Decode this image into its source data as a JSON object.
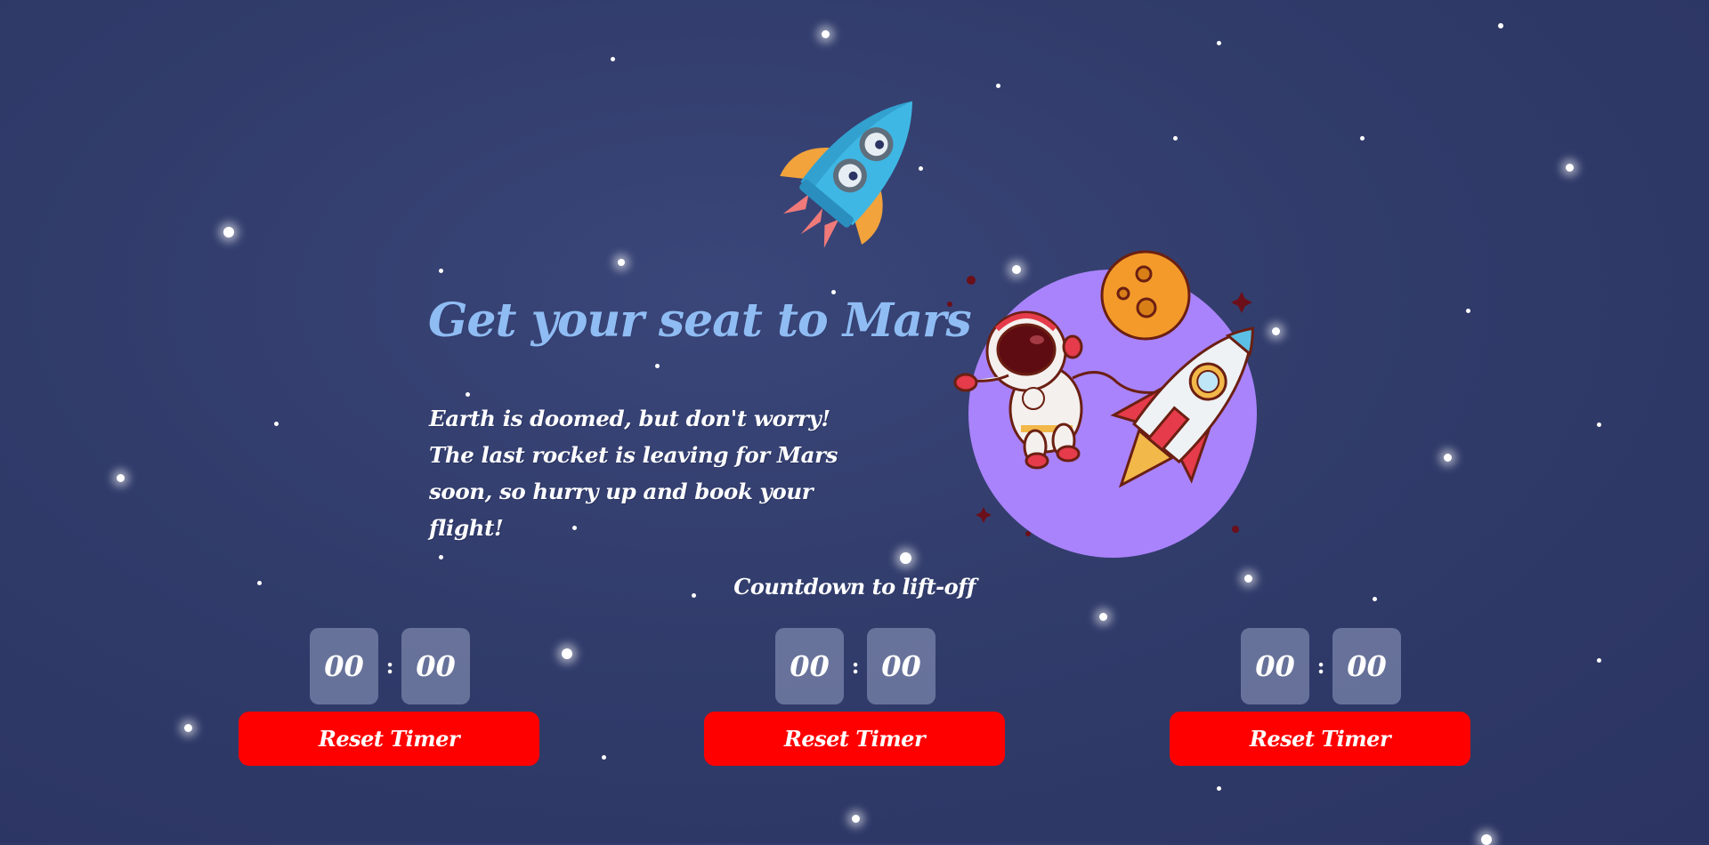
{
  "hero": {
    "title": "Get your seat to Mars",
    "description": "Earth is doomed, but don't worry! The last rocket is leaving for Mars soon, so hurry up and book your flight!"
  },
  "countdown": {
    "label": "Countdown to lift-off"
  },
  "timers": [
    {
      "minutes": "00",
      "separator": ":",
      "seconds": "00",
      "reset_label": "Reset Timer"
    },
    {
      "minutes": "00",
      "separator": ":",
      "seconds": "00",
      "reset_label": "Reset Timer"
    },
    {
      "minutes": "00",
      "separator": ":",
      "seconds": "00",
      "reset_label": "Reset Timer"
    }
  ],
  "colors": {
    "background": "#313c6b",
    "title": "#8fbcf3",
    "reset_button": "#ff0000",
    "timer_box": "#7a82a8",
    "planet_circle": "#a983fb"
  },
  "icons": {
    "cartoon_rocket": "blue-rocket-icon",
    "illustration": "astronaut-planet-rocket-illustration"
  }
}
